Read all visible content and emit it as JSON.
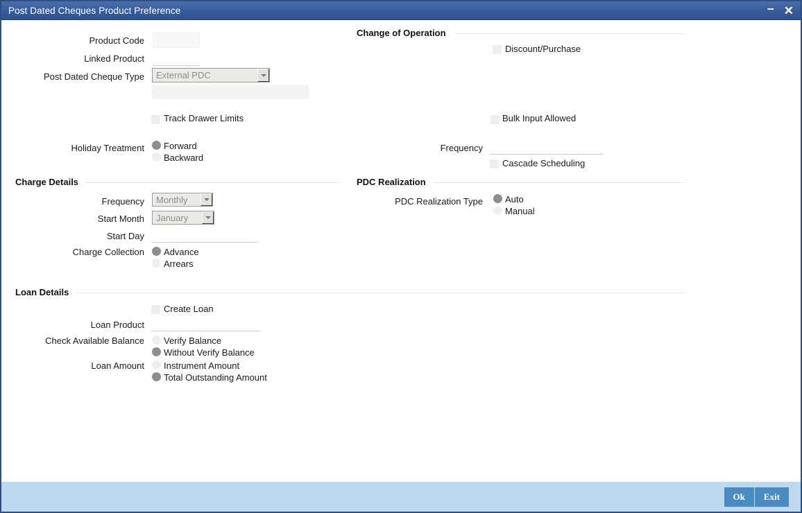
{
  "window": {
    "title": "Post Dated Cheques Product Preference",
    "minimize_label": "–",
    "close_label": "✕"
  },
  "left_top": {
    "product_code_label": "Product Code",
    "product_code_value": "",
    "linked_product_label": "Linked Product",
    "linked_product_value": "",
    "pdc_type_label": "Post Dated Cheque Type",
    "pdc_type_value": "External PDC",
    "track_drawer_limits_label": "Track Drawer Limits",
    "holiday_treatment_label": "Holiday Treatment",
    "holiday_forward_label": "Forward",
    "holiday_backward_label": "Backward"
  },
  "change_of_operation": {
    "section_title": "Change of Operation",
    "discount_purchase_label": "Discount/Purchase",
    "bulk_input_allowed_label": "Bulk Input Allowed",
    "frequency_label": "Frequency",
    "frequency_value": "",
    "cascade_scheduling_label": "Cascade Scheduling"
  },
  "charge_details": {
    "section_title": "Charge Details",
    "frequency_label": "Frequency",
    "frequency_value": "Monthly",
    "start_month_label": "Start Month",
    "start_month_value": "January",
    "start_day_label": "Start Day",
    "start_day_value": "",
    "charge_collection_label": "Charge Collection",
    "advance_label": "Advance",
    "arrears_label": "Arrears"
  },
  "pdc_realization": {
    "section_title": "PDC Realization",
    "type_label": "PDC Realization Type",
    "auto_label": "Auto",
    "manual_label": "Manual"
  },
  "loan_details": {
    "section_title": "Loan Details",
    "create_loan_label": "Create Loan",
    "loan_product_label": "Loan Product",
    "loan_product_value": "",
    "check_available_balance_label": "Check Available Balance",
    "verify_balance_label": "Verify Balance",
    "without_verify_balance_label": "Without Verify Balance",
    "loan_amount_label": "Loan Amount",
    "instrument_amount_label": "Instrument Amount",
    "total_outstanding_amount_label": "Total Outstanding Amount"
  },
  "footer": {
    "ok_label": "Ok",
    "exit_label": "Exit"
  },
  "colors": {
    "titlebar": "#3a5f9e",
    "window_border": "#2d4f81",
    "footer_bar": "#bed8ed",
    "button": "#4a8cc2",
    "radio_selected": "#8e8e8e",
    "radio_unselected": "#efefef",
    "checkbox": "#eeeeee"
  }
}
